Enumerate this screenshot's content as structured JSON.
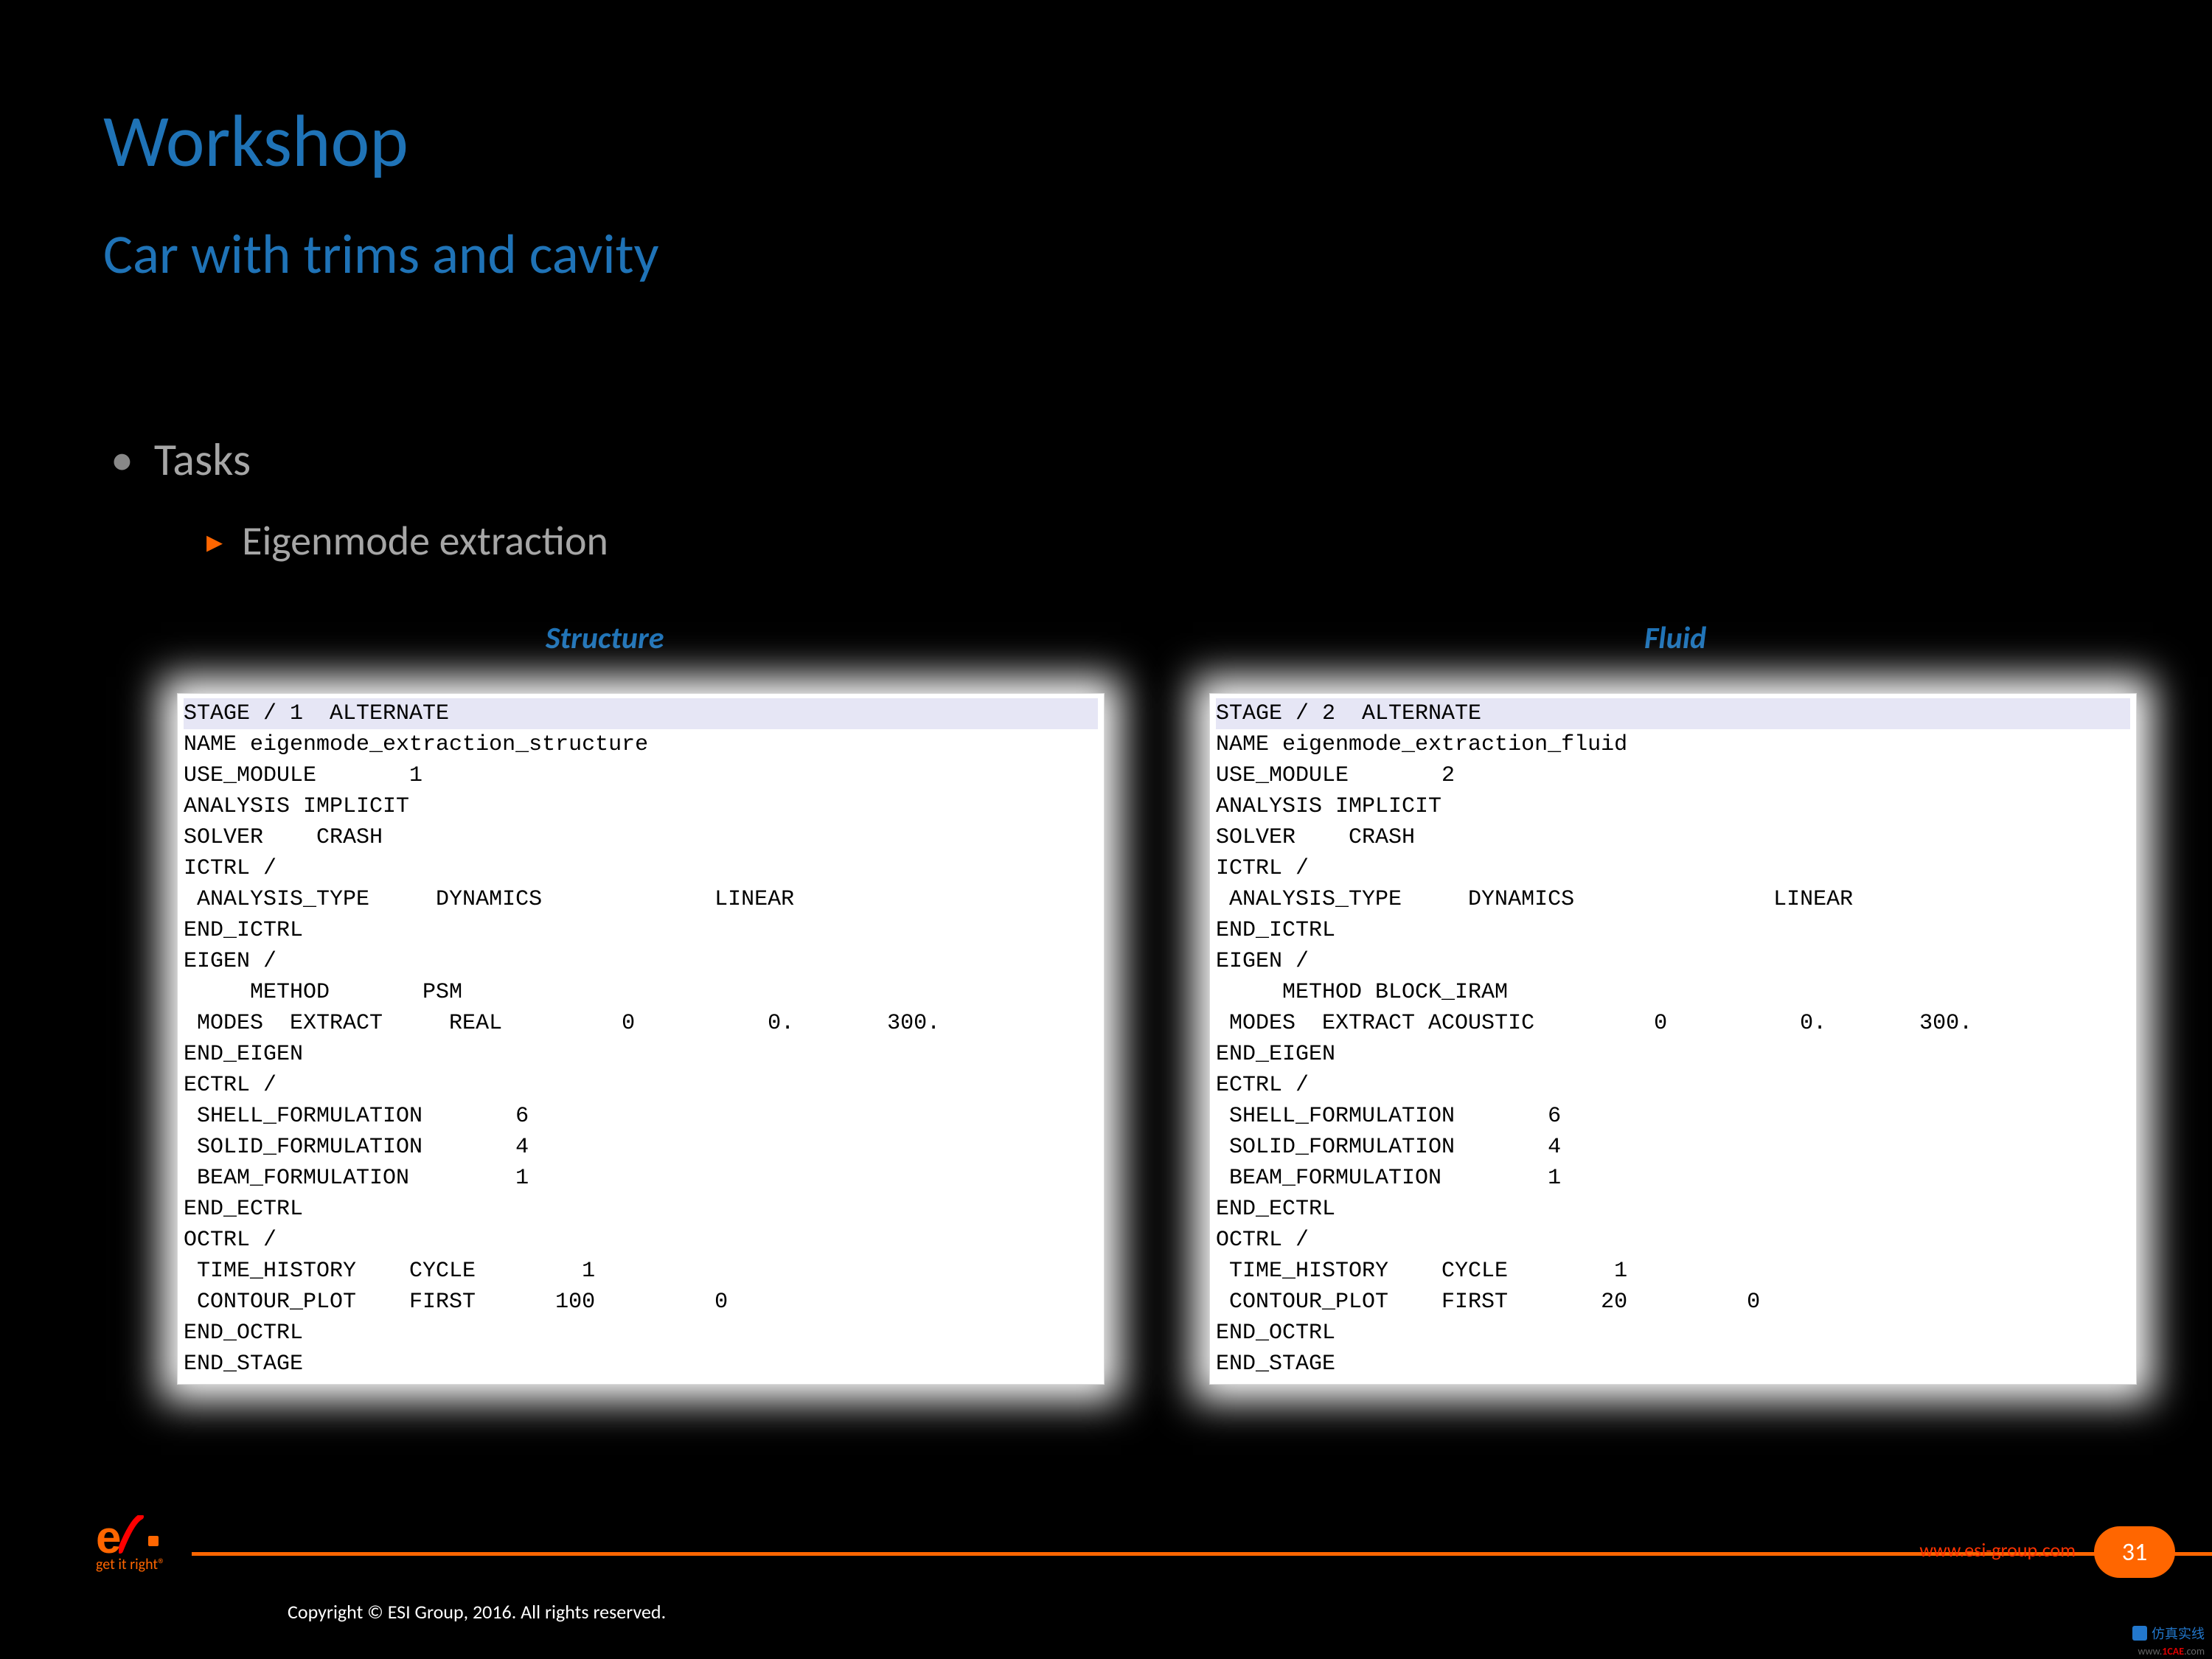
{
  "title": "Workshop",
  "subtitle": "Car with trims and cavity",
  "bullets": {
    "level1": "Tasks",
    "level2": "Eigenmode extraction"
  },
  "columns": {
    "left_label": "Structure",
    "right_label": "Fluid"
  },
  "code_left": {
    "stage_line": "STAGE / 1  ALTERNATE",
    "body": "NAME eigenmode_extraction_structure\nUSE_MODULE       1\nANALYSIS IMPLICIT\nSOLVER    CRASH\nICTRL /\n ANALYSIS_TYPE     DYNAMICS             LINEAR\nEND_ICTRL\nEIGEN /\n     METHOD       PSM\n MODES  EXTRACT     REAL         0          0.       300.\nEND_EIGEN\nECTRL /\n SHELL_FORMULATION       6\n SOLID_FORMULATION       4\n BEAM_FORMULATION        1\nEND_ECTRL\nOCTRL /\n TIME_HISTORY    CYCLE        1\n CONTOUR_PLOT    FIRST      100         0\nEND_OCTRL\nEND_STAGE"
  },
  "code_right": {
    "stage_line": "STAGE / 2  ALTERNATE",
    "body": "NAME eigenmode_extraction_fluid\nUSE_MODULE       2\nANALYSIS IMPLICIT\nSOLVER    CRASH\nICTRL /\n ANALYSIS_TYPE     DYNAMICS               LINEAR\nEND_ICTRL\nEIGEN /\n     METHOD BLOCK_IRAM\n MODES  EXTRACT ACOUSTIC         0          0.       300.\nEND_EIGEN\nECTRL /\n SHELL_FORMULATION       6\n SOLID_FORMULATION       4\n BEAM_FORMULATION        1\nEND_ECTRL\nOCTRL /\n TIME_HISTORY    CYCLE        1\n CONTOUR_PLOT    FIRST       20         0\nEND_OCTRL\nEND_STAGE"
  },
  "footer": {
    "tagline": "get it right®",
    "copyright": "Copyright © ESI Group, 2016. All rights reserved.",
    "url": "www.esi-group.com",
    "page": "31"
  },
  "watermark": {
    "cn": "仿真实线",
    "url_prefix": "www.",
    "url_mid": "1CAE",
    "url_suffix": ".com"
  }
}
